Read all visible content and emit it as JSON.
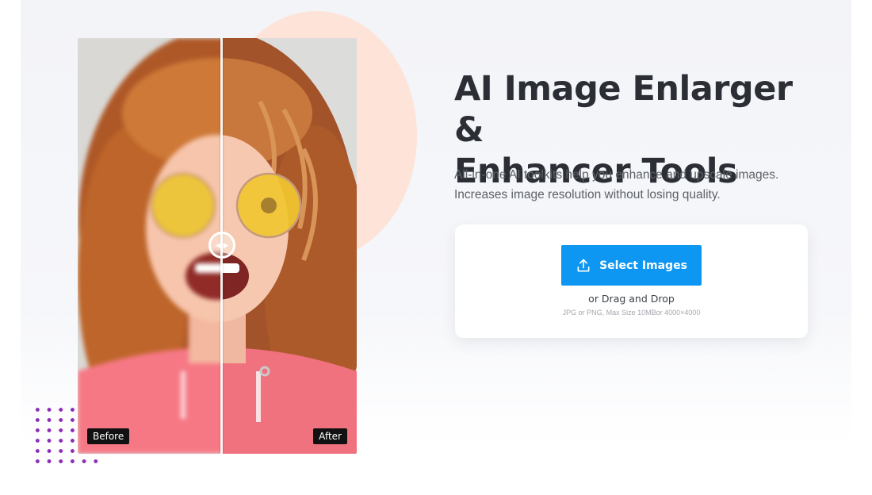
{
  "compare": {
    "before_label": "Before",
    "after_label": "After",
    "handle_icons": [
      "chevron-left-icon",
      "chevron-right-icon"
    ]
  },
  "hero": {
    "headline_line1": "AI Image Enlarger &",
    "headline_line2": "Enhancer Tools",
    "subtitle_line1": "All-in-one AI toolkits help you enhance and upscale images.",
    "subtitle_line2": "Increases image resolution without losing quality."
  },
  "upload": {
    "button_label": "Select Images",
    "button_icon": "upload-icon",
    "drag_text": "or Drag and Drop",
    "limits_text": "JPG or PNG, Max Size 10MBor 4000×4000"
  },
  "colors": {
    "accent_button": "#0d96f2",
    "deco_circle": "#fde3d8",
    "dots": "#8e2bb8",
    "headline": "#2b2f35"
  }
}
